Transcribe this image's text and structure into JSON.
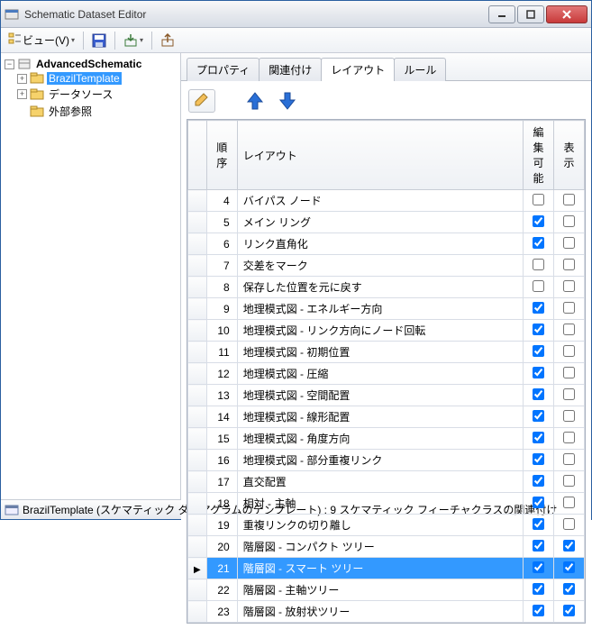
{
  "window": {
    "title": "Schematic Dataset Editor"
  },
  "toolbar": {
    "view_label": "ビュー(V)"
  },
  "tree": {
    "root": "AdvancedSchematic",
    "items": [
      {
        "label": "BrazilTemplate",
        "selected": true
      },
      {
        "label": "データソース",
        "selected": false
      },
      {
        "label": "外部参照",
        "selected": false
      }
    ]
  },
  "tabs": {
    "items": [
      {
        "label": "プロパティ",
        "active": false
      },
      {
        "label": "関連付け",
        "active": false
      },
      {
        "label": "レイアウト",
        "active": true
      },
      {
        "label": "ルール",
        "active": false
      }
    ]
  },
  "grid": {
    "headers": {
      "order": "順序",
      "layout": "レイアウト",
      "editable": "編集可能",
      "display": "表示"
    },
    "rows": [
      {
        "order": 4,
        "layout": "バイパス ノード",
        "editable": false,
        "display": false,
        "selected": false
      },
      {
        "order": 5,
        "layout": "メイン リング",
        "editable": true,
        "display": false,
        "selected": false
      },
      {
        "order": 6,
        "layout": "リンク直角化",
        "editable": true,
        "display": false,
        "selected": false
      },
      {
        "order": 7,
        "layout": "交差をマーク",
        "editable": false,
        "display": false,
        "selected": false
      },
      {
        "order": 8,
        "layout": "保存した位置を元に戻す",
        "editable": false,
        "display": false,
        "selected": false
      },
      {
        "order": 9,
        "layout": "地理模式図 - エネルギー方向",
        "editable": true,
        "display": false,
        "selected": false
      },
      {
        "order": 10,
        "layout": "地理模式図 - リンク方向にノード回転",
        "editable": true,
        "display": false,
        "selected": false
      },
      {
        "order": 11,
        "layout": "地理模式図 - 初期位置",
        "editable": true,
        "display": false,
        "selected": false
      },
      {
        "order": 12,
        "layout": "地理模式図 - 圧縮",
        "editable": true,
        "display": false,
        "selected": false
      },
      {
        "order": 13,
        "layout": "地理模式図 - 空間配置",
        "editable": true,
        "display": false,
        "selected": false
      },
      {
        "order": 14,
        "layout": "地理模式図 - 線形配置",
        "editable": true,
        "display": false,
        "selected": false
      },
      {
        "order": 15,
        "layout": "地理模式図 - 角度方向",
        "editable": true,
        "display": false,
        "selected": false
      },
      {
        "order": 16,
        "layout": "地理模式図 - 部分重複リンク",
        "editable": true,
        "display": false,
        "selected": false
      },
      {
        "order": 17,
        "layout": "直交配置",
        "editable": true,
        "display": false,
        "selected": false
      },
      {
        "order": 18,
        "layout": "相対 - 主軸",
        "editable": true,
        "display": false,
        "selected": false
      },
      {
        "order": 19,
        "layout": "重複リンクの切り離し",
        "editable": true,
        "display": false,
        "selected": false
      },
      {
        "order": 20,
        "layout": "階層図 - コンパクト ツリー",
        "editable": true,
        "display": true,
        "selected": false
      },
      {
        "order": 21,
        "layout": "階層図 - スマート ツリー",
        "editable": true,
        "display": true,
        "selected": true
      },
      {
        "order": 22,
        "layout": "階層図 - 主軸ツリー",
        "editable": true,
        "display": true,
        "selected": false
      },
      {
        "order": 23,
        "layout": "階層図 - 放射状ツリー",
        "editable": true,
        "display": true,
        "selected": false
      }
    ]
  },
  "status": {
    "text": "BrazilTemplate (スケマティック ダイアグラムのテンプレート) : 9 スケマティック フィーチャクラスの関連付け"
  }
}
